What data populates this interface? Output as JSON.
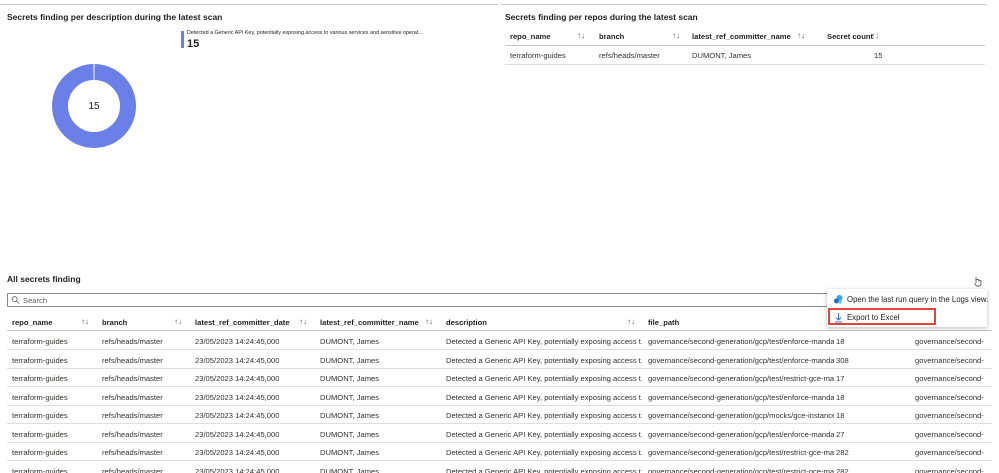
{
  "left_panel": {
    "title": "Secrets finding per description during the latest scan",
    "legend_label": "Detected a Generic API Key, potentially exposing access to various services and sensitive operat...",
    "legend_value": "15",
    "donut_center": "15",
    "accent_color": "#6b7fe8"
  },
  "chart_data": {
    "type": "pie",
    "categories": [
      "Detected a Generic API Key, potentially exposing access to various services and sensitive operat..."
    ],
    "values": [
      15
    ],
    "title": "Secrets finding per description during the latest scan"
  },
  "right_panel": {
    "title": "Secrets finding per repos during the latest scan",
    "columns": [
      "repo_name",
      "branch",
      "latest_ref_committer_name",
      "Secret count"
    ],
    "rows": [
      [
        "terraform-guides",
        "refs/heads/master",
        "DUMONT, James",
        "15"
      ]
    ]
  },
  "all_secrets": {
    "title": "All secrets finding",
    "search_placeholder": "Search",
    "columns": [
      "repo_name",
      "branch",
      "latest_ref_committer_date",
      "latest_ref_committer_name",
      "description",
      "file_path"
    ],
    "rows": [
      [
        "terraform-guides",
        "refs/heads/master",
        "23/05/2023 14:24:45,000",
        "DUMONT, James",
        "Detected a Generic API Key, potentially exposing access t...",
        "governance/second-generation/gcp/test/enforce-mandat...",
        "18",
        "governance/second-"
      ],
      [
        "terraform-guides",
        "refs/heads/master",
        "23/05/2023 14:24:45,000",
        "DUMONT, James",
        "Detected a Generic API Key, potentially exposing access t...",
        "governance/second-generation/gcp/test/enforce-mandat...",
        "308",
        "governance/second-"
      ],
      [
        "terraform-guides",
        "refs/heads/master",
        "23/05/2023 14:24:45,000",
        "DUMONT, James",
        "Detected a Generic API Key, potentially exposing access t...",
        "governance/second-generation/gcp/test/restrict-gce-ma...",
        "17",
        "governance/second-"
      ],
      [
        "terraform-guides",
        "refs/heads/master",
        "23/05/2023 14:24:45,000",
        "DUMONT, James",
        "Detected a Generic API Key, potentially exposing access t...",
        "governance/second-generation/gcp/test/enforce-mandat...",
        "18",
        "governance/second-"
      ],
      [
        "terraform-guides",
        "refs/heads/master",
        "23/05/2023 14:24:45,000",
        "DUMONT, James",
        "Detected a Generic API Key, potentially exposing access t...",
        "governance/second-generation/gcp/mocks/gce-instance...",
        "18",
        "governance/second-"
      ],
      [
        "terraform-guides",
        "refs/heads/master",
        "23/05/2023 14:24:45,000",
        "DUMONT, James",
        "Detected a Generic API Key, potentially exposing access t...",
        "governance/second-generation/gcp/test/enforce-mandat...",
        "27",
        "governance/second-"
      ],
      [
        "terraform-guides",
        "refs/heads/master",
        "23/05/2023 14:24:45,000",
        "DUMONT, James",
        "Detected a Generic API Key, potentially exposing access t...",
        "governance/second-generation/gcp/test/restrict-gce-ma...",
        "282",
        "governance/second-"
      ],
      [
        "terraform-guides",
        "refs/heads/master",
        "23/05/2023 14:24:45,000",
        "DUMONT, James",
        "Detected a Generic API Key, potentially exposing access t...",
        "governance/second-generation/gcp/test/restrict-gce-ma...",
        "282",
        "governance/second-"
      ]
    ]
  },
  "context_menu": {
    "items": [
      {
        "label": "Open the last run query in the Logs view.",
        "icon": "logs-icon"
      },
      {
        "label": "Export to Excel",
        "icon": "download-icon"
      }
    ],
    "highlight_color": "#e0443b"
  }
}
